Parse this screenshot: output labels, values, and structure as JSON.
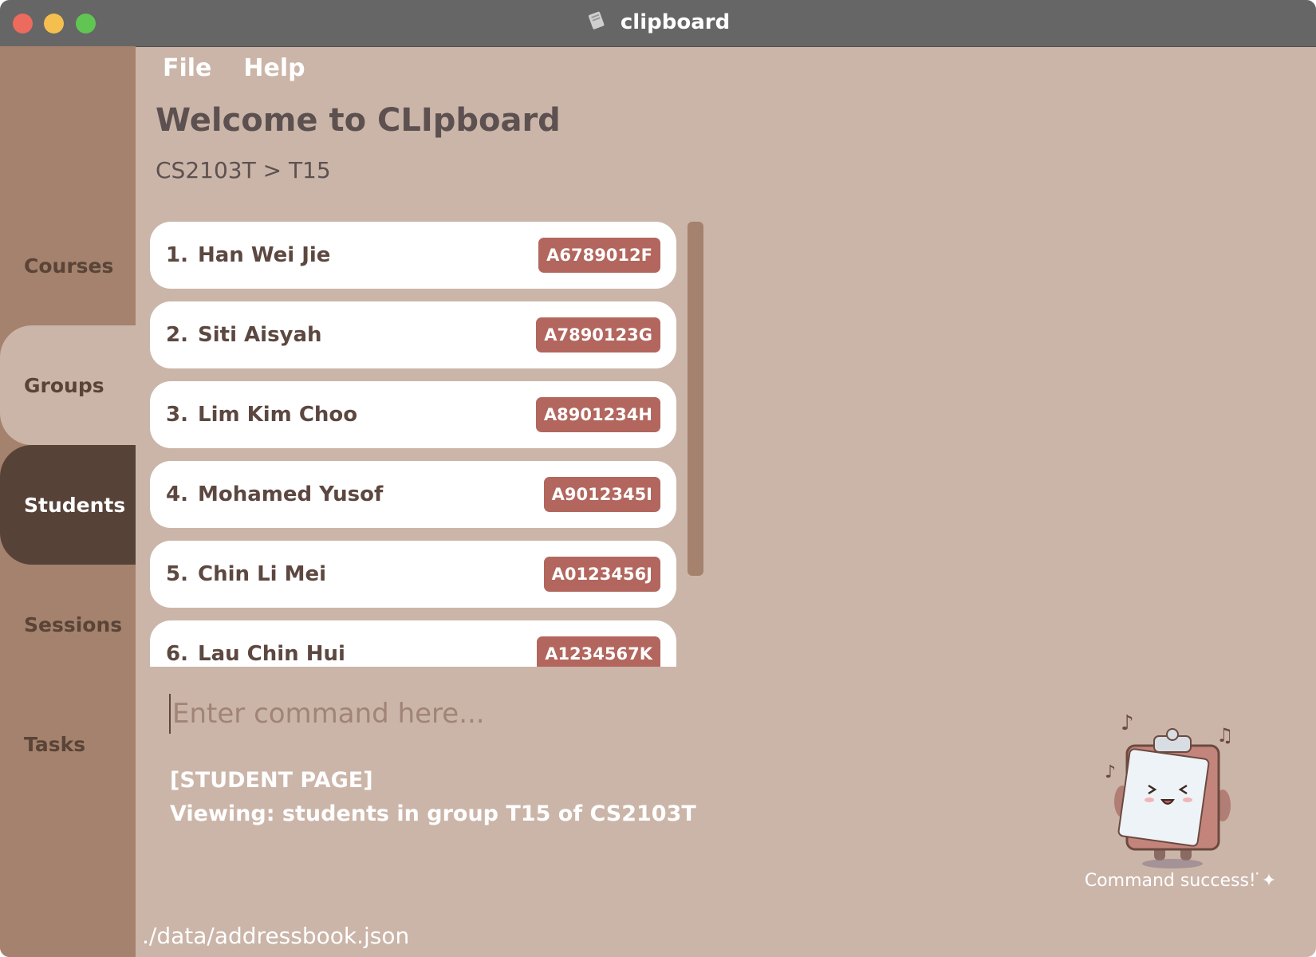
{
  "window": {
    "title": "clipboard",
    "icon": "clipboard-icon"
  },
  "sidebar": {
    "items": [
      {
        "label": "Courses",
        "state": "default"
      },
      {
        "label": "Groups",
        "state": "selected-light"
      },
      {
        "label": "Students",
        "state": "active"
      },
      {
        "label": "Sessions",
        "state": "default"
      },
      {
        "label": "Tasks",
        "state": "default"
      }
    ]
  },
  "menu": {
    "file": "File",
    "help": "Help"
  },
  "header": {
    "title": "Welcome to CLIpboard",
    "breadcrumb": "CS2103T > T15"
  },
  "students": [
    {
      "index": "1.",
      "name": "Han Wei Jie",
      "id": "A6789012F"
    },
    {
      "index": "2.",
      "name": "Siti Aisyah",
      "id": "A7890123G"
    },
    {
      "index": "3.",
      "name": "Lim Kim Choo",
      "id": "A8901234H"
    },
    {
      "index": "4.",
      "name": "Mohamed Yusof",
      "id": "A9012345I"
    },
    {
      "index": "5.",
      "name": "Chin Li Mei",
      "id": "A0123456J"
    },
    {
      "index": "6.",
      "name": "Lau Chin Hui",
      "id": "A1234567K"
    }
  ],
  "command": {
    "placeholder": "Enter command here...",
    "value": ""
  },
  "result": {
    "line1": "[STUDENT PAGE]",
    "line2": "Viewing: students in group T15 of CS2103T"
  },
  "mascot": {
    "caption": "Command success! ̇✦"
  },
  "status": {
    "file_path": "./data/addressbook.json"
  },
  "colors": {
    "background": "#cbb5a8",
    "sidebar": "#a4826d",
    "active_tab": "#574238",
    "badge": "#b2665d",
    "titlebar": "#666666"
  }
}
